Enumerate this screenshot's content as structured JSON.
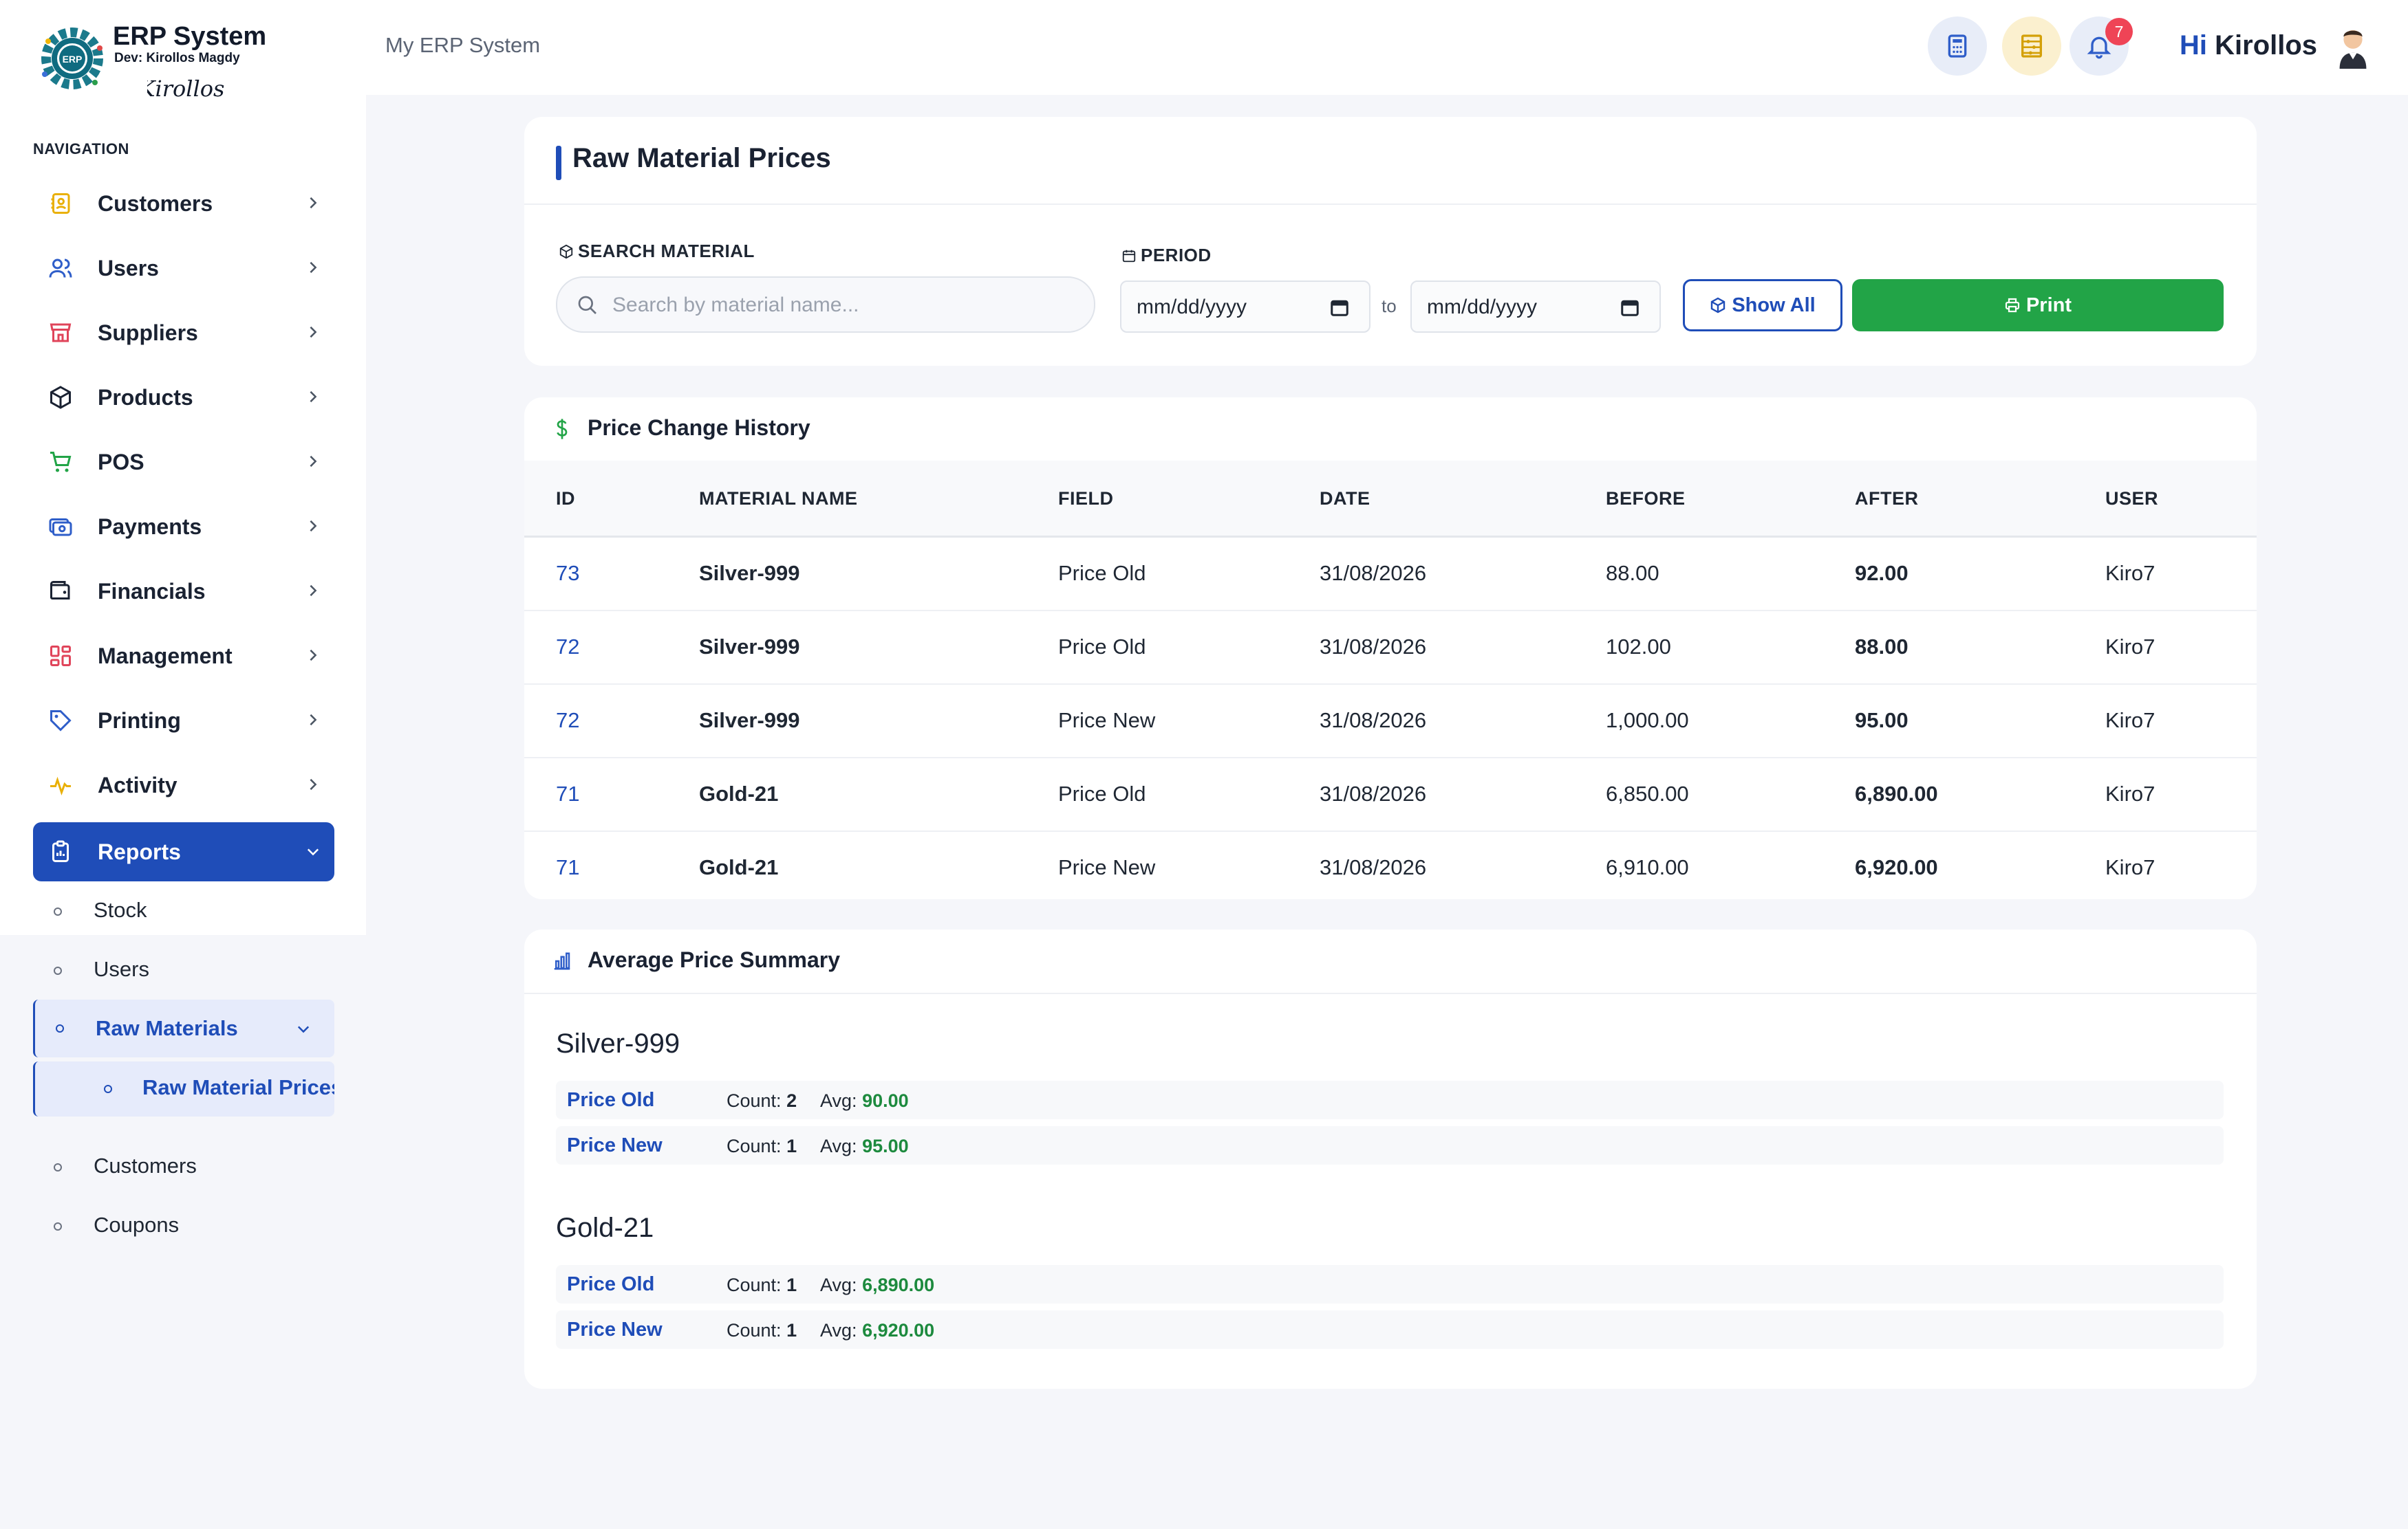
{
  "brand": {
    "title": "ERP System",
    "dev": "Dev: Kirollos Magdy",
    "signature": "Kirollos",
    "logo_text": "ERP"
  },
  "sidebar": {
    "heading": "NAVIGATION",
    "items": [
      {
        "label": "Customers",
        "icon": "contact-book-icon"
      },
      {
        "label": "Users",
        "icon": "users-icon"
      },
      {
        "label": "Suppliers",
        "icon": "store-icon"
      },
      {
        "label": "Products",
        "icon": "box-icon"
      },
      {
        "label": "POS",
        "icon": "cart-icon"
      },
      {
        "label": "Payments",
        "icon": "payments-icon"
      },
      {
        "label": "Financials",
        "icon": "wallet-icon"
      },
      {
        "label": "Management",
        "icon": "grid-icon"
      },
      {
        "label": "Printing",
        "icon": "tag-icon"
      },
      {
        "label": "Activity",
        "icon": "activity-icon"
      },
      {
        "label": "Reports",
        "icon": "clipboard-icon"
      }
    ],
    "reports_sub": [
      {
        "label": "Stock"
      },
      {
        "label": "Users"
      },
      {
        "label": "Raw Materials"
      },
      {
        "label": "Customers"
      },
      {
        "label": "Coupons"
      }
    ],
    "raw_materials_sub": [
      {
        "label": "Raw Material Prices"
      }
    ]
  },
  "header": {
    "breadcrumb": "My ERP System",
    "notifications": "7",
    "greeting_hi": "Hi",
    "greeting_name": "Kirollos"
  },
  "filters": {
    "page_title": "Raw Material Prices",
    "search_label": "SEARCH MATERIAL",
    "search_placeholder": "Search by material name...",
    "search_value": "",
    "period_label": "PERIOD",
    "date_from": "mm/dd/yyyy",
    "to_label": "to",
    "date_to": "mm/dd/yyyy",
    "show_all": "Show All",
    "print": "Print"
  },
  "history": {
    "title": "Price Change History",
    "columns": [
      "ID",
      "MATERIAL NAME",
      "FIELD",
      "DATE",
      "BEFORE",
      "AFTER",
      "USER"
    ],
    "rows": [
      {
        "id": "73",
        "name": "Silver-999",
        "field": "Price Old",
        "date": "31/08/2026",
        "before": "88.00",
        "after": "92.00",
        "user": "Kiro7"
      },
      {
        "id": "72",
        "name": "Silver-999",
        "field": "Price Old",
        "date": "31/08/2026",
        "before": "102.00",
        "after": "88.00",
        "user": "Kiro7"
      },
      {
        "id": "72",
        "name": "Silver-999",
        "field": "Price New",
        "date": "31/08/2026",
        "before": "1,000.00",
        "after": "95.00",
        "user": "Kiro7"
      },
      {
        "id": "71",
        "name": "Gold-21",
        "field": "Price Old",
        "date": "31/08/2026",
        "before": "6,850.00",
        "after": "6,890.00",
        "user": "Kiro7"
      },
      {
        "id": "71",
        "name": "Gold-21",
        "field": "Price New",
        "date": "31/08/2026",
        "before": "6,910.00",
        "after": "6,920.00",
        "user": "Kiro7"
      }
    ]
  },
  "summary": {
    "title": "Average Price Summary",
    "count_label": "Count:",
    "avg_label": "Avg:",
    "groups": [
      {
        "name": "Silver-999",
        "rows": [
          {
            "field": "Price Old",
            "count": "2",
            "avg": "90.00"
          },
          {
            "field": "Price New",
            "count": "1",
            "avg": "95.00"
          }
        ]
      },
      {
        "name": "Gold-21",
        "rows": [
          {
            "field": "Price Old",
            "count": "1",
            "avg": "6,890.00"
          },
          {
            "field": "Price New",
            "count": "1",
            "avg": "6,920.00"
          }
        ]
      }
    ]
  },
  "colors": {
    "primary": "#1f4db8",
    "success": "#22a447",
    "badge": "#ef4456",
    "background": "#f5f6fa"
  }
}
